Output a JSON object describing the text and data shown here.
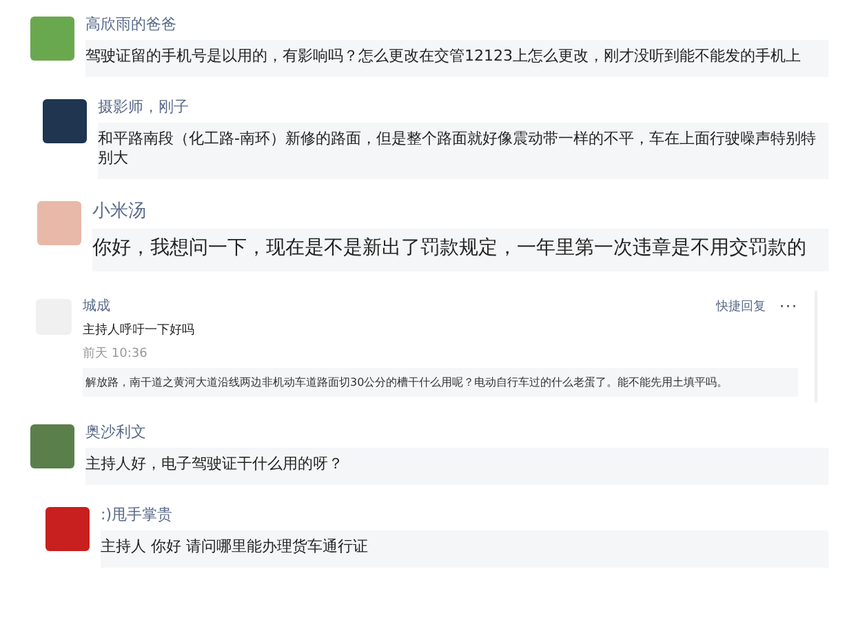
{
  "comments": [
    {
      "kind": "simple",
      "author": "高欣雨的爸爸",
      "text": "驾驶证留的手机号是以用的，有影响吗？怎么更改在交管12123上怎么更改，刚才没听到能不能发的手机上"
    },
    {
      "kind": "simple",
      "author": "摄影师，刚子",
      "text": "和平路南段（化工路-南环）新修的路面，但是整个路面就好像震动带一样的不平，车在上面行驶噪声特别特别大"
    },
    {
      "kind": "large",
      "author": "小米汤",
      "text": "你好，我想问一下，现在是不是新出了罚款规定，一年里第一次违章是不用交罚款的"
    },
    {
      "kind": "detailed",
      "author": "城成",
      "text": "主持人呼吁一下好吗",
      "time": "前天 10:36",
      "reply_label": "快捷回复",
      "more": "···",
      "quote": "解放路，南干道之黄河大道沿线两边非机动车道路面切30公分的槽干什么用呢？电动自行车过的什么老蛋了。能不能先用土填平吗。"
    },
    {
      "kind": "simple",
      "author": "奥沙利文",
      "text": "主持人好，电子驾驶证干什么用的呀？"
    },
    {
      "kind": "simple",
      "author": ":)甩手掌贵",
      "text": "主持人 你好 请问哪里能办理货车通行证"
    }
  ]
}
